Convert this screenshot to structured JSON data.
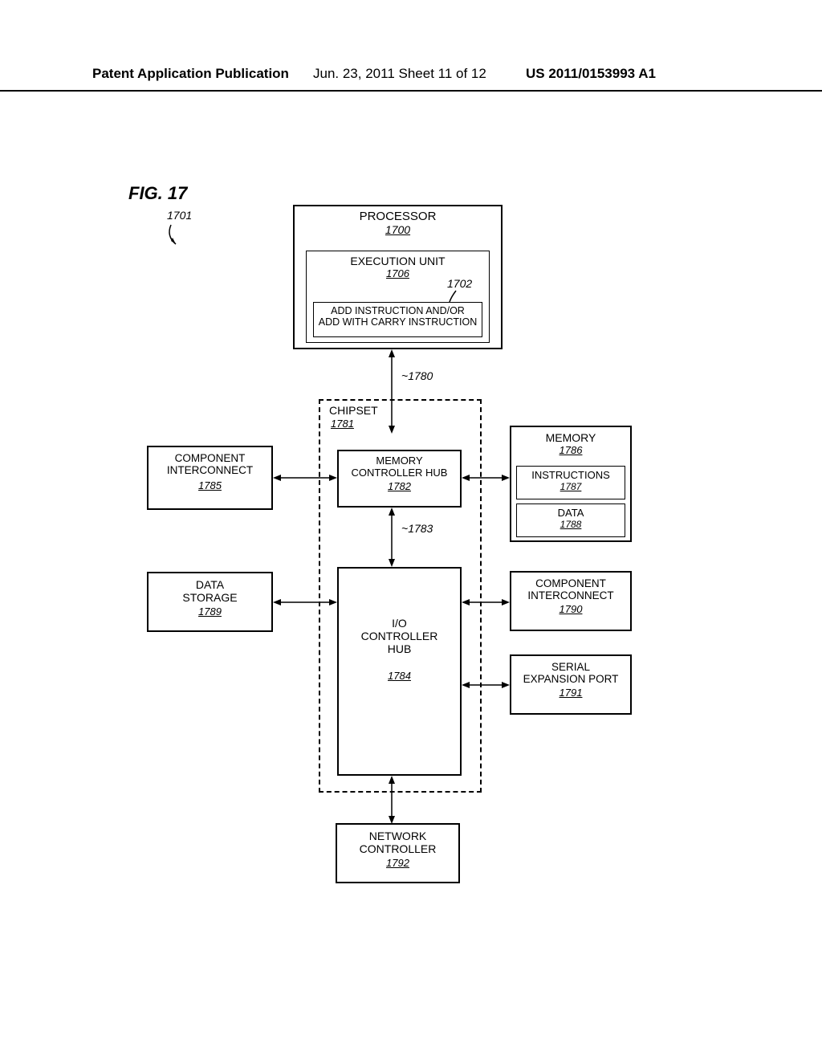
{
  "header": {
    "left": "Patent Application Publication",
    "mid": "Jun. 23, 2011  Sheet 11 of 12",
    "right": "US 2011/0153993 A1"
  },
  "fig_label": "FIG. 17",
  "ref_1701": "1701",
  "processor": {
    "title": "PROCESSOR",
    "num": "1700"
  },
  "exec_unit": {
    "title": "EXECUTION UNIT",
    "num": "1706"
  },
  "ref_1702": "1702",
  "add_instr": {
    "line1": "ADD INSTRUCTION AND/OR",
    "line2": "ADD WITH CARRY INSTRUCTION"
  },
  "ref_1780": "1780",
  "chipset": {
    "title": "CHIPSET",
    "num": "1781"
  },
  "mch": {
    "title": "MEMORY CONTROLLER HUB",
    "num": "1782"
  },
  "ref_1783": "1783",
  "ich": {
    "title": "I/O CONTROLLER HUB",
    "num": "1784"
  },
  "comp_inter_left": {
    "title": "COMPONENT INTERCONNECT",
    "num": "1785"
  },
  "memory": {
    "title": "MEMORY",
    "num": "1786"
  },
  "instructions": {
    "title": "INSTRUCTIONS",
    "num": "1787"
  },
  "data_box": {
    "title": "DATA",
    "num": "1788"
  },
  "data_storage": {
    "title": "DATA STORAGE",
    "num": "1789"
  },
  "comp_inter_right": {
    "title": "COMPONENT INTERCONNECT",
    "num": "1790"
  },
  "serial_port": {
    "title": "SERIAL EXPANSION PORT",
    "num": "1791"
  },
  "network": {
    "title": "NETWORK CONTROLLER",
    "num": "1792"
  }
}
